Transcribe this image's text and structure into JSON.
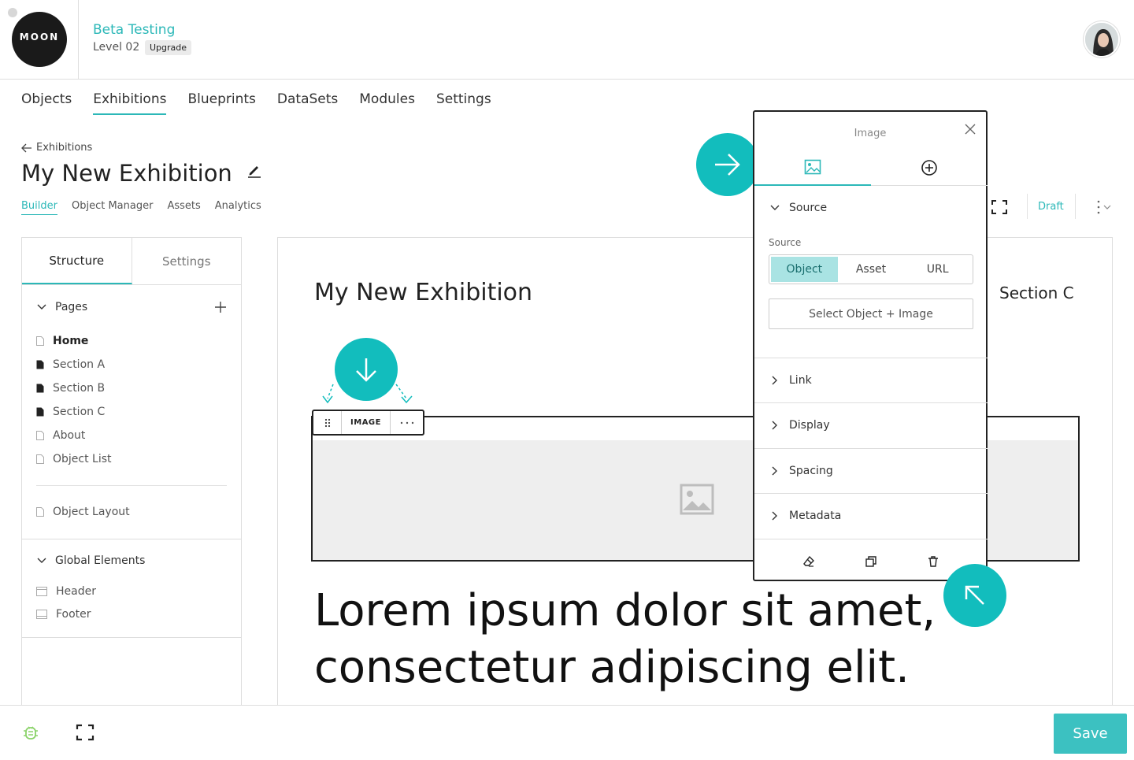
{
  "header": {
    "logo_text": "MOON",
    "project_title": "Beta Testing",
    "level": "Level 02",
    "upgrade_label": "Upgrade"
  },
  "main_nav": {
    "items": [
      {
        "label": "Objects"
      },
      {
        "label": "Exhibitions",
        "active": true
      },
      {
        "label": "Blueprints"
      },
      {
        "label": "DataSets"
      },
      {
        "label": "Modules"
      },
      {
        "label": "Settings"
      }
    ]
  },
  "breadcrumb": {
    "back_label": "Exhibitions"
  },
  "page": {
    "title": "My New Exhibition"
  },
  "subtabs": {
    "items": [
      {
        "label": "Builder",
        "active": true
      },
      {
        "label": "Object Manager"
      },
      {
        "label": "Assets"
      },
      {
        "label": "Analytics"
      }
    ]
  },
  "toolbar": {
    "status_label": "Draft"
  },
  "left_panel": {
    "tabs": [
      {
        "label": "Structure",
        "active": true
      },
      {
        "label": "Settings"
      }
    ],
    "pages_heading": "Pages",
    "pages": [
      {
        "label": "Home",
        "filled": false
      },
      {
        "label": "Section A",
        "filled": true
      },
      {
        "label": "Section B",
        "filled": true
      },
      {
        "label": "Section C",
        "filled": true
      },
      {
        "label": "About",
        "filled": false
      },
      {
        "label": "Object List",
        "filled": false
      }
    ],
    "object_layout": "Object Layout",
    "global_heading": "Global Elements",
    "global_items": [
      {
        "label": "Header"
      },
      {
        "label": "Footer"
      }
    ]
  },
  "canvas": {
    "title": "My New Exhibition",
    "section_label": "Section C",
    "block_label": "IMAGE",
    "lorem": "Lorem ipsum dolor sit amet, consectetur adipiscing elit."
  },
  "image_panel": {
    "title": "Image",
    "source_heading": "Source",
    "source_label": "Source",
    "source_options": [
      {
        "label": "Object",
        "active": true
      },
      {
        "label": "Asset"
      },
      {
        "label": "URL"
      }
    ],
    "select_button": "Select Object + Image",
    "sections": [
      {
        "label": "Link"
      },
      {
        "label": "Display"
      },
      {
        "label": "Spacing"
      },
      {
        "label": "Metadata"
      }
    ]
  },
  "bottom_bar": {
    "save_label": "Save"
  },
  "colors": {
    "accent": "#2cb8b8",
    "teal_circle": "#12bdbd",
    "save": "#3cc1c1"
  }
}
